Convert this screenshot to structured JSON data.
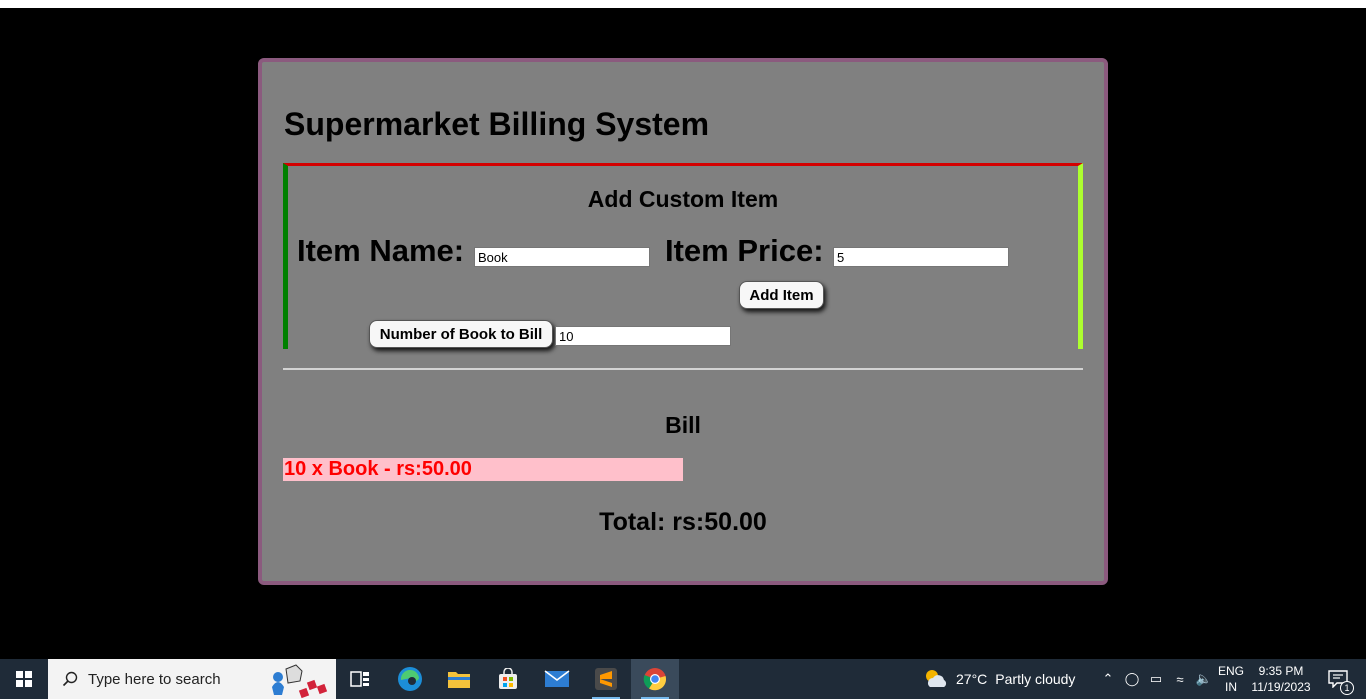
{
  "app": {
    "title": "Supermarket Billing System"
  },
  "custom_item": {
    "heading": "Add Custom Item",
    "name_label": "Item Name:",
    "name_value": "Book",
    "price_label": "Item Price:",
    "price_value": "5",
    "add_button": "Add Item",
    "qty_button": "Number of Book to Bill",
    "qty_value": "10"
  },
  "bill": {
    "heading": "Bill",
    "lines": [
      "10 x Book - rs:50.00"
    ],
    "total": "Total: rs:50.00"
  },
  "taskbar": {
    "search_placeholder": "Type here to search",
    "weather_temp": "27°C",
    "weather_condition": "Partly cloudy",
    "lang_top": "ENG",
    "lang_bottom": "IN",
    "time": "9:35 PM",
    "date": "11/19/2023",
    "notification_count": "1",
    "pinned_apps": [
      "task-view",
      "edge",
      "file-explorer",
      "store",
      "mail",
      "sublime-text",
      "chrome"
    ]
  },
  "colors": {
    "panel_bg": "#808080",
    "panel_border": "#8b5a7e",
    "box_top_border": "#d40000",
    "box_left_border": "#008000",
    "box_right_border": "#adff2f",
    "bill_line_bg": "#ffc0cb",
    "bill_line_text": "#ff0000",
    "taskbar_bg": "#1f2b38"
  }
}
